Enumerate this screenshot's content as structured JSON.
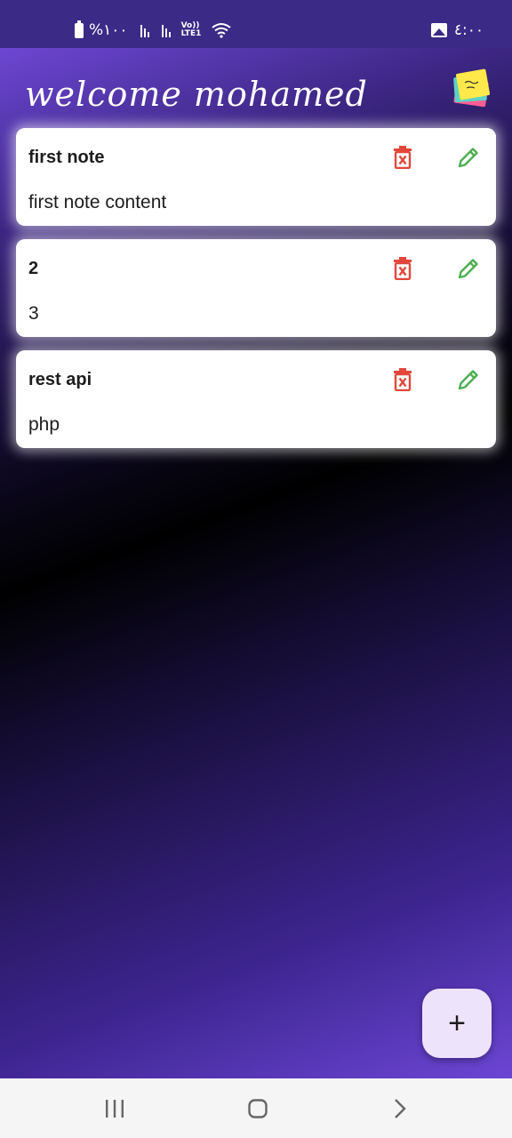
{
  "status_bar": {
    "battery_text": "%١٠٠",
    "lte_top": "Vo))",
    "lte_bottom": "LTE1",
    "time": "٤:٠٠"
  },
  "header": {
    "welcome_text": "welcome mohamed",
    "logo_icon": "sticky-notes-logo"
  },
  "notes": [
    {
      "title": "first note",
      "content": "first note content"
    },
    {
      "title": "2",
      "content": "3"
    },
    {
      "title": "rest api",
      "content": "php"
    }
  ],
  "fab": {
    "label": "+"
  },
  "colors": {
    "delete": "#e2473a",
    "edit": "#4caf50",
    "status_bar": "#3b2a86",
    "fab_bg": "#ede4fc"
  }
}
